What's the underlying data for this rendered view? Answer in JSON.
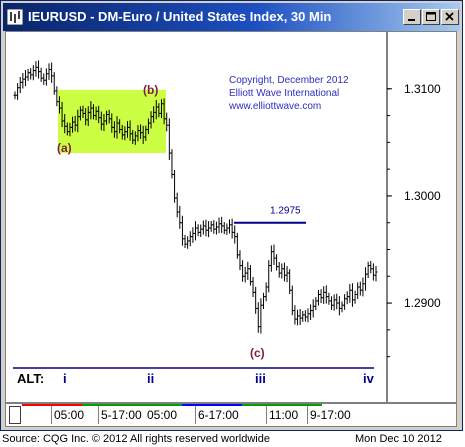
{
  "window": {
    "title": "IEURUSD - DM-Euro / United States Index, 30 Min",
    "buttons": [
      "minimize",
      "maximize",
      "close"
    ]
  },
  "chart_data": {
    "type": "ohlc",
    "title": "IEURUSD - DM-Euro / United States Index, 30 Min",
    "ylim": [
      1.2845,
      1.3125
    ],
    "y_ticks": [
      1.31,
      1.3,
      1.29
    ],
    "y_tick_labels": [
      "1.3100",
      "1.3000",
      "1.2900"
    ],
    "x_labels": [
      "05:00",
      "5-17:00",
      "05:00",
      "6-17:00",
      "11:00",
      "9-17:00"
    ],
    "series": [
      {
        "values": [
          1.3094,
          1.3101,
          1.3106,
          1.3109,
          1.3111,
          1.3115,
          1.3113,
          1.3117,
          1.312,
          1.3116,
          1.311,
          1.3108,
          1.3114,
          1.3118,
          1.3112,
          1.3098,
          1.3088,
          1.3082,
          1.307,
          1.3065,
          1.306,
          1.3064,
          1.3069,
          1.3066,
          1.3074,
          1.308,
          1.3077,
          1.3071,
          1.3078,
          1.3082,
          1.3075,
          1.3079,
          1.3073,
          1.3067,
          1.307,
          1.3076,
          1.3072,
          1.3064,
          1.306,
          1.3068,
          1.3062,
          1.3057,
          1.306,
          1.3064,
          1.3058,
          1.3052,
          1.3056,
          1.3061,
          1.3059,
          1.3055,
          1.3062,
          1.3068,
          1.3074,
          1.3078,
          1.3083,
          1.3077,
          1.3086,
          1.3072,
          1.3066,
          1.304,
          1.302,
          1.2998,
          1.2985,
          1.2975,
          1.296,
          1.2955,
          1.2958,
          1.2962,
          1.2965,
          1.297,
          1.2966,
          1.2969,
          1.2972,
          1.2968,
          1.297,
          1.2973,
          1.2969,
          1.2971,
          1.2974,
          1.2972,
          1.2968,
          1.297,
          1.2973,
          1.2966,
          1.2962,
          1.2945,
          1.2935,
          1.2925,
          1.2928,
          1.2932,
          1.292,
          1.291,
          1.2895,
          1.2878,
          1.2898,
          1.2906,
          1.2915,
          1.2935,
          1.2948,
          1.2942,
          1.2934,
          1.2928,
          1.2932,
          1.2926,
          1.2928,
          1.2912,
          1.2893,
          1.2885,
          1.2888,
          1.2886,
          1.2889,
          1.2887,
          1.289,
          1.2893,
          1.2897,
          1.2902,
          1.2908,
          1.2905,
          1.291,
          1.2906,
          1.2902,
          1.2898,
          1.2903,
          1.29,
          1.2895,
          1.2898,
          1.2904,
          1.2906,
          1.2912,
          1.2903,
          1.2908,
          1.2915,
          1.2912,
          1.2918,
          1.2927,
          1.2935,
          1.2932,
          1.2926,
          1.2929
        ],
        "color": "#000000"
      }
    ],
    "highlight_box": {
      "y_top": 1.3099,
      "y_bottom": 1.304,
      "color": "#ccff44"
    },
    "target_line": {
      "y": 1.2975,
      "label": "1.2975",
      "color": "#00008b"
    },
    "wave_labels": [
      {
        "text": "(a)",
        "color": "#7b1f3f"
      },
      {
        "text": "(b)",
        "color": "#7b1f3f"
      },
      {
        "text": "(c)",
        "color": "#7b1f3f"
      }
    ],
    "alt_count": {
      "prefix": "ALT:",
      "labels": [
        "i",
        "ii",
        "iii",
        "iv"
      ],
      "color": "#00008b"
    },
    "copyright": [
      "Copyright, December 2012",
      "Elliott Wave International",
      "www.elliottwave.com"
    ],
    "copyright_color": "#2e2ec0"
  },
  "footer": {
    "source": "Source: CQG Inc. © 2012 All rights reserved worldwide",
    "date": "Mon Dec 10 2012"
  },
  "colors": {
    "title_bar": "#0a246a",
    "frame": "#d4d0c8"
  }
}
